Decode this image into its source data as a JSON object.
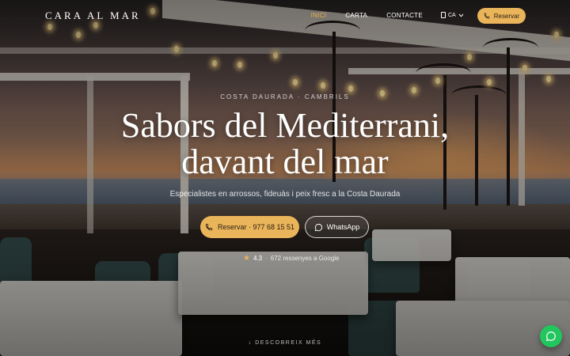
{
  "header": {
    "logo": "CARA AL MAR",
    "nav": [
      {
        "label": "INICI",
        "active": true
      },
      {
        "label": "CARTA",
        "active": false
      },
      {
        "label": "CONTACTE",
        "active": false
      }
    ],
    "language": "CA",
    "reserve_label": "Reservar"
  },
  "hero": {
    "eyebrow": "COSTA DAURADA · CAMBRILS",
    "title_line1": "Sabors del Mediterrani,",
    "title_line2": "davant del mar",
    "subtitle": "Especialistes en arrossos, fideuàs i peix fresc a la Costa Daurada",
    "reserve_button": "Reservar · 977 68 15 51",
    "whatsapp_button": "WhatsApp",
    "rating": {
      "score": "4.3",
      "separator": "·",
      "reviews": "672 ressenyes a Google"
    },
    "scroll_hint": "↓ DESCOBREIX MÉS"
  },
  "icons": {
    "phone": "phone-icon",
    "whatsapp": "whatsapp-icon",
    "globe": "globe-icon",
    "chevron": "chevron-down-icon",
    "star": "star-icon",
    "chat": "chat-icon"
  },
  "colors": {
    "accent": "#e9b45a",
    "nav_active": "#e8b04a",
    "chat_fab": "#22c55e"
  }
}
